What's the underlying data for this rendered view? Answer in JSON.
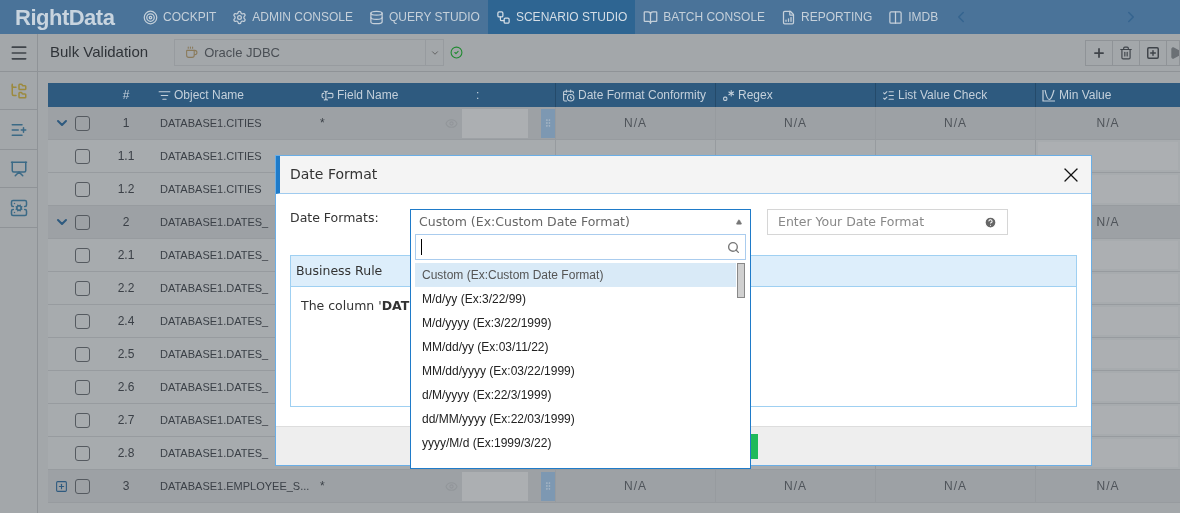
{
  "nav": {
    "logo": "RightData",
    "tabs": [
      {
        "label": "COCKPIT",
        "selected": false
      },
      {
        "label": "ADMIN CONSOLE",
        "selected": false
      },
      {
        "label": "QUERY STUDIO",
        "selected": false
      },
      {
        "label": "SCENARIO STUDIO",
        "selected": true
      },
      {
        "label": "BATCH CONSOLE",
        "selected": false
      },
      {
        "label": "REPORTING",
        "selected": false
      },
      {
        "label": "IMDB",
        "selected": false
      }
    ]
  },
  "toolbar": {
    "title": "Bulk Validation",
    "connection": "Oracle JDBC",
    "connected": true
  },
  "table": {
    "columns": [
      "#",
      "Object Name",
      "Field Name",
      ":",
      "Date Format Conformity",
      "Regex",
      "List Value Check",
      "Min Value"
    ],
    "rows": [
      {
        "number": "1",
        "object": "DATABASE1.CITIES",
        "field": "*",
        "kind": "parent",
        "expanded": true,
        "checked": false,
        "checks": {
          "date_format": "N/A",
          "regex": "N/A",
          "list_value": "N/A",
          "min_value": "N/A"
        }
      },
      {
        "number": "1.1",
        "object": "DATABASE1.CITIES",
        "kind": "child",
        "checked": false
      },
      {
        "number": "1.2",
        "object": "DATABASE1.CITIES",
        "kind": "child",
        "checked": false
      },
      {
        "number": "2",
        "object": "DATABASE1.DATES_",
        "kind": "parent",
        "expanded": true,
        "checked": false,
        "checks": {
          "min_value": "N/A"
        }
      },
      {
        "number": "2.1",
        "object": "DATABASE1.DATES_",
        "kind": "child",
        "checked": false
      },
      {
        "number": "2.2",
        "object": "DATABASE1.DATES_",
        "kind": "child",
        "checked": false
      },
      {
        "number": "2.4",
        "object": "DATABASE1.DATES_",
        "kind": "child",
        "checked": false
      },
      {
        "number": "2.5",
        "object": "DATABASE1.DATES_",
        "kind": "child",
        "checked": false
      },
      {
        "number": "2.6",
        "object": "DATABASE1.DATES_",
        "kind": "child",
        "checked": false
      },
      {
        "number": "2.7",
        "object": "DATABASE1.DATES_",
        "kind": "child",
        "checked": false
      },
      {
        "number": "2.8",
        "object": "DATABASE1.DATES_",
        "kind": "child",
        "checked": false
      },
      {
        "number": "3",
        "object": "DATABASE1.EMPLOYEE_S...",
        "field": "*",
        "kind": "parent",
        "expanded": false,
        "checked": false,
        "checks": {
          "date_format": "N/A",
          "regex": "N/A",
          "list_value": "N/A",
          "min_value": "N/A"
        }
      }
    ]
  },
  "dialog": {
    "title": "Date Format",
    "date_formats_label": "Date Formats:",
    "select": {
      "value": "Custom (Ex:Custom Date Format)",
      "expanded": true,
      "options": [
        {
          "label": "Custom (Ex:Custom Date Format)",
          "selected": true
        },
        {
          "label": "M/d/yy (Ex:3/22/99)",
          "selected": false
        },
        {
          "label": "M/d/yyyy (Ex:3/22/1999)",
          "selected": false
        },
        {
          "label": "MM/dd/yy (Ex:03/11/22)",
          "selected": false
        },
        {
          "label": "MM/dd/yyyy (Ex:03/22/1999)",
          "selected": false
        },
        {
          "label": "d/M/yyyy (Ex:22/3/1999)",
          "selected": false
        },
        {
          "label": "dd/MM/yyyy (Ex:22/03/1999)",
          "selected": false
        },
        {
          "label": "yyyy/M/d (Ex:1999/3/22)",
          "selected": false
        }
      ]
    },
    "custom_format": {
      "placeholder": "Enter Your Date Format"
    },
    "business_rule": {
      "title": "Business Rule",
      "text": "The column '**DAT**"
    }
  }
}
